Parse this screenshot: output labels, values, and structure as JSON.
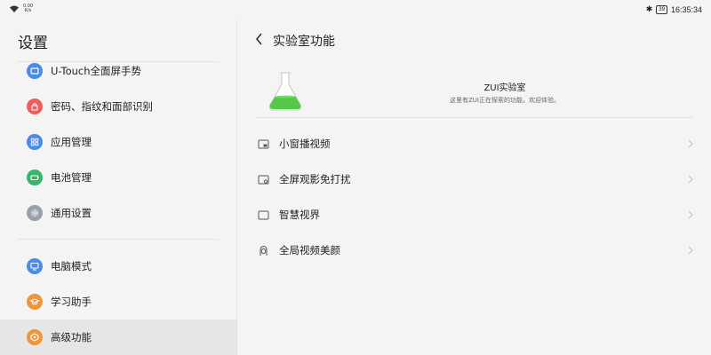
{
  "status": {
    "net_speed": "0.00",
    "net_unit": "K/s",
    "battery": "39",
    "time": "16:35:34"
  },
  "sidebar": {
    "title": "设置",
    "items": [
      {
        "label": "U-Touch全面屏手势",
        "icon": "gesture-icon",
        "color": "#4a8ae8"
      },
      {
        "label": "密码、指纹和面部识别",
        "icon": "lock-icon",
        "color": "#ee5f5b"
      },
      {
        "label": "应用管理",
        "icon": "apps-icon",
        "color": "#4a8ae8"
      },
      {
        "label": "电池管理",
        "icon": "battery-icon",
        "color": "#35b76a"
      },
      {
        "label": "通用设置",
        "icon": "gear-icon",
        "color": "#9aa0a6"
      },
      {
        "label": "电脑模式",
        "icon": "desktop-icon",
        "color": "#4a8ae8"
      },
      {
        "label": "学习助手",
        "icon": "graduation-cap-icon",
        "color": "#f0953a"
      },
      {
        "label": "高级功能",
        "icon": "advanced-icon",
        "color": "#f0953a"
      }
    ],
    "active_label": "高级功能"
  },
  "main": {
    "title": "实验室功能",
    "lab_name": "ZUI实验室",
    "lab_desc": "这里有ZUI正在探索的功能，欢迎体验。",
    "accent": "#55c84a",
    "rows": [
      {
        "label": "小窗播视频",
        "icon": "mini-window-icon"
      },
      {
        "label": "全屏观影免打扰",
        "icon": "screen-settings-icon"
      },
      {
        "label": "智慧视界",
        "icon": "screen-icon"
      },
      {
        "label": "全局视频美颜",
        "icon": "face-icon"
      }
    ]
  }
}
